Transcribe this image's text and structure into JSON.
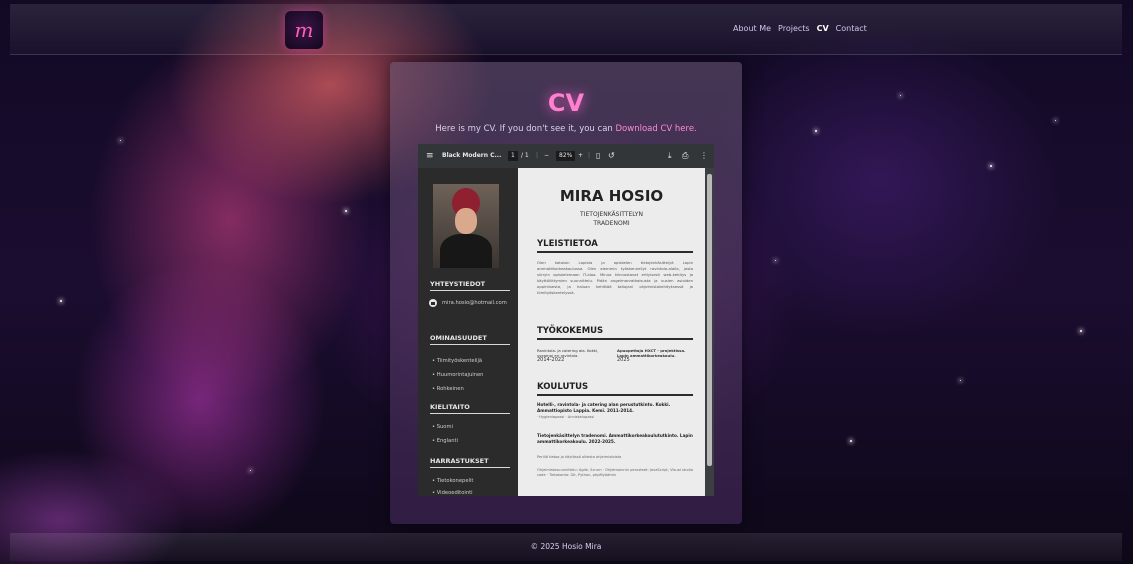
{
  "header": {
    "logo_letter": "m",
    "nav": [
      "About Me",
      "Projects",
      "CV",
      "Contact"
    ],
    "active_nav": "CV"
  },
  "main": {
    "title": "CV",
    "intro_text": "Here is my CV. If you don't see it, you can ",
    "intro_link": "Download CV here."
  },
  "pdf_viewer": {
    "file_name": "Black Modern C...",
    "current_page": "1",
    "page_total": "/ 1",
    "zoom": "82%",
    "zoom_out": "−",
    "zoom_in": "+",
    "icons": [
      "menu-icon",
      "fit-page-icon",
      "rotate-icon",
      "download-icon",
      "print-icon",
      "more-icon"
    ]
  },
  "cv": {
    "name": "MIRA HOSIO",
    "subtitle_line1": "TIETOJENKÄSITTELYN",
    "subtitle_line2": "TRADENOMI",
    "contact_heading": "YHTEYSTIEDOT",
    "email": "mira.hosio@hotmail.com",
    "skills_heading": "OMINAISUUDET",
    "skills": [
      "Tiimityöskentelijä",
      "Huumorintajuinen",
      "Rohkeinen"
    ],
    "languages_heading": "KIELITAITO",
    "languages": [
      "Suomi",
      "Englanti"
    ],
    "hobbies_heading": "HARRASTUKSET",
    "hobbies": [
      "Tietokonepelit",
      "Videoeditointi"
    ],
    "general_heading": "YLEISTIETOA",
    "general_text": "Olen kotoisin Lapista ja opiskelen tietojenkäsittelyä Lapin ammattikorkeakoulussa. Olen aiemmin työskennellyt ravintola-alalla, josta siirryin opiskelemaan IT-alaa. Minua kiinnostavat erityisesti web-kehitys ja käyttöliittymien suunnittelu. Pidän ongelmanratkaisusta ja uusien asioiden oppimisesta, ja haluan kehittää taitojani ohjelmistokehityksessä ja tiimityöskentelyssä.",
    "work_heading": "TYÖKOKEMUS",
    "work": [
      {
        "title": "Ravintola- ja catering ala. Kokki, useampi eri ravintola.",
        "years": "2014-2022"
      },
      {
        "title": "Apuopettaja HXCT - projektissa. Lapin ammattikorkeakoulu.",
        "years": "2025"
      }
    ],
    "education_heading": "KOULUTUS",
    "edu1_title": "Hotelli-, ravintola- ja catering alan perustutkinto. Kokki. Ammattiopisto Lappia. Kemi. 2011-2014.",
    "edu1_detail": "· Hygieniapassi · Anniskelupassi",
    "edu2_title": "Tietojenkäsittelyn tradenomi. Ammattikorkeakoulututkinto. Lapin ammattikorkeakoulu. 2022-2025.",
    "edu2_detail": "Perillä tietoa ja käytössä olleista ohjelmistoista",
    "edu2_more": "Ohjelmistosuunnittelu: Agile, Scrum · Ohjelmoinnin perusteet: JavaScript, Visual studio code · Tietokanta: Git, Python, phpMyAdmin"
  },
  "footer": {
    "text": "© 2025 Hosio Mira"
  }
}
